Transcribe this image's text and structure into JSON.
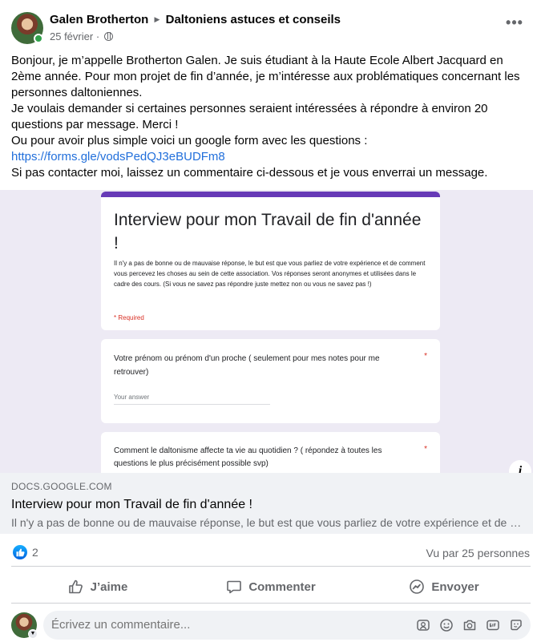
{
  "post": {
    "author": "Galen Brotherton",
    "group": "Daltoniens astuces et conseils",
    "date": "25 février",
    "separator": "·",
    "more_label": "•••",
    "text": {
      "line1": "Bonjour, je m’appelle Brotherton Galen. Je suis étudiant à la Haute Ecole Albert Jacquard en 2ème année. Pour mon projet de fin d’année, je m’intéresse aux problématiques concernant les personnes daltoniennes.",
      "line2": "Je voulais demander si certaines personnes seraient intéressées à répondre à environ 20 questions par message. Merci !",
      "line3": "Ou pour avoir plus simple voici un google form avec les questions :",
      "link": "https://forms.gle/vodsPedQJ3eBUDFm8",
      "line4": "Si pas contacter moi, laissez un commentaire ci-dessous et je vous enverrai un message."
    }
  },
  "preview": {
    "form_title": "Interview pour mon Travail de fin d'année !",
    "form_desc": "Il n'y a pas de bonne ou de mauvaise réponse, le but est que vous parliez de votre expérience et de comment vous percevez les choses au sein de cette association. Vos réponses seront anonymes et utilisées dans le cadre des cours. (Si vous ne savez pas répondre juste mettez non ou vous ne savez pas !)",
    "required": "* Required",
    "q1": "Votre prénom ou prénom d'un proche ( seulement pour mes notes pour me retrouver)",
    "q1_answer": "Your answer",
    "q2": "Comment le daltonisme affecte ta vie au quotidien ? ( répondez à toutes les questions le plus précisément possible svp)",
    "star": "*",
    "info": "i"
  },
  "link_card": {
    "domain": "DOCS.GOOGLE.COM",
    "title": "Interview pour mon Travail de fin d'année !",
    "description": "Il n'y a pas de bonne ou de mauvaise réponse, le but est que vous parliez de votre expérience et de comment vous percevez les choses au sein de cette association."
  },
  "stats": {
    "reactions_count": "2",
    "seen_by": "Vu par 25 personnes"
  },
  "actions": {
    "like": "J’aime",
    "comment": "Commenter",
    "send": "Envoyer"
  },
  "comment": {
    "placeholder": "Écrivez un commentaire..."
  },
  "colors": {
    "accent": "#216fdb",
    "form_purple": "#673ab7",
    "required_red": "#d93025"
  }
}
